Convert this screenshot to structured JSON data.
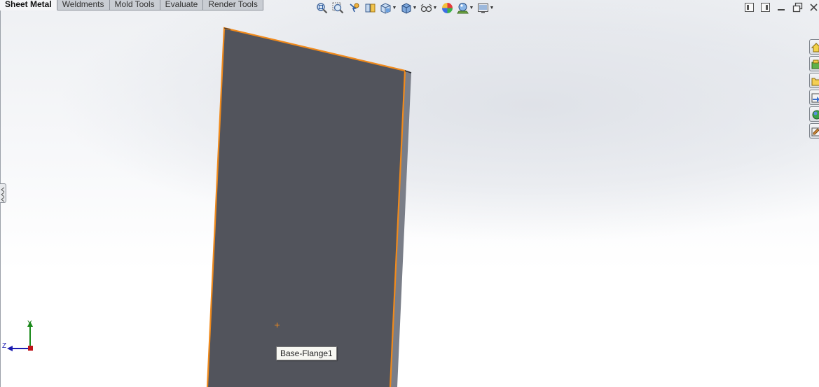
{
  "command_manager": {
    "tabs": [
      {
        "label": "Sheet Metal",
        "active": true
      },
      {
        "label": "Weldments",
        "active": false
      },
      {
        "label": "Mold Tools",
        "active": false
      },
      {
        "label": "Evaluate",
        "active": false
      },
      {
        "label": "Render Tools",
        "active": false
      }
    ]
  },
  "heads_up_toolbar": {
    "icons": [
      "zoom-to-fit-icon",
      "zoom-to-area-icon",
      "previous-view-icon",
      "section-view-icon",
      "view-orientation-icon",
      "display-style-icon",
      "hide-show-items-icon",
      "edit-appearance-icon",
      "apply-scene-icon",
      "view-settings-icon"
    ]
  },
  "graphics_area": {
    "tooltip": "Base-Flange1",
    "part_color": "#52545c",
    "edge_highlight_color": "#f08a1c",
    "triad": {
      "y_label": "Y",
      "z_label": "Z"
    }
  },
  "task_pane": {
    "icons": [
      "solidworks-resources-icon",
      "design-library-icon",
      "file-explorer-icon",
      "view-palette-icon",
      "appearances-scenes-icon",
      "custom-properties-icon"
    ]
  }
}
